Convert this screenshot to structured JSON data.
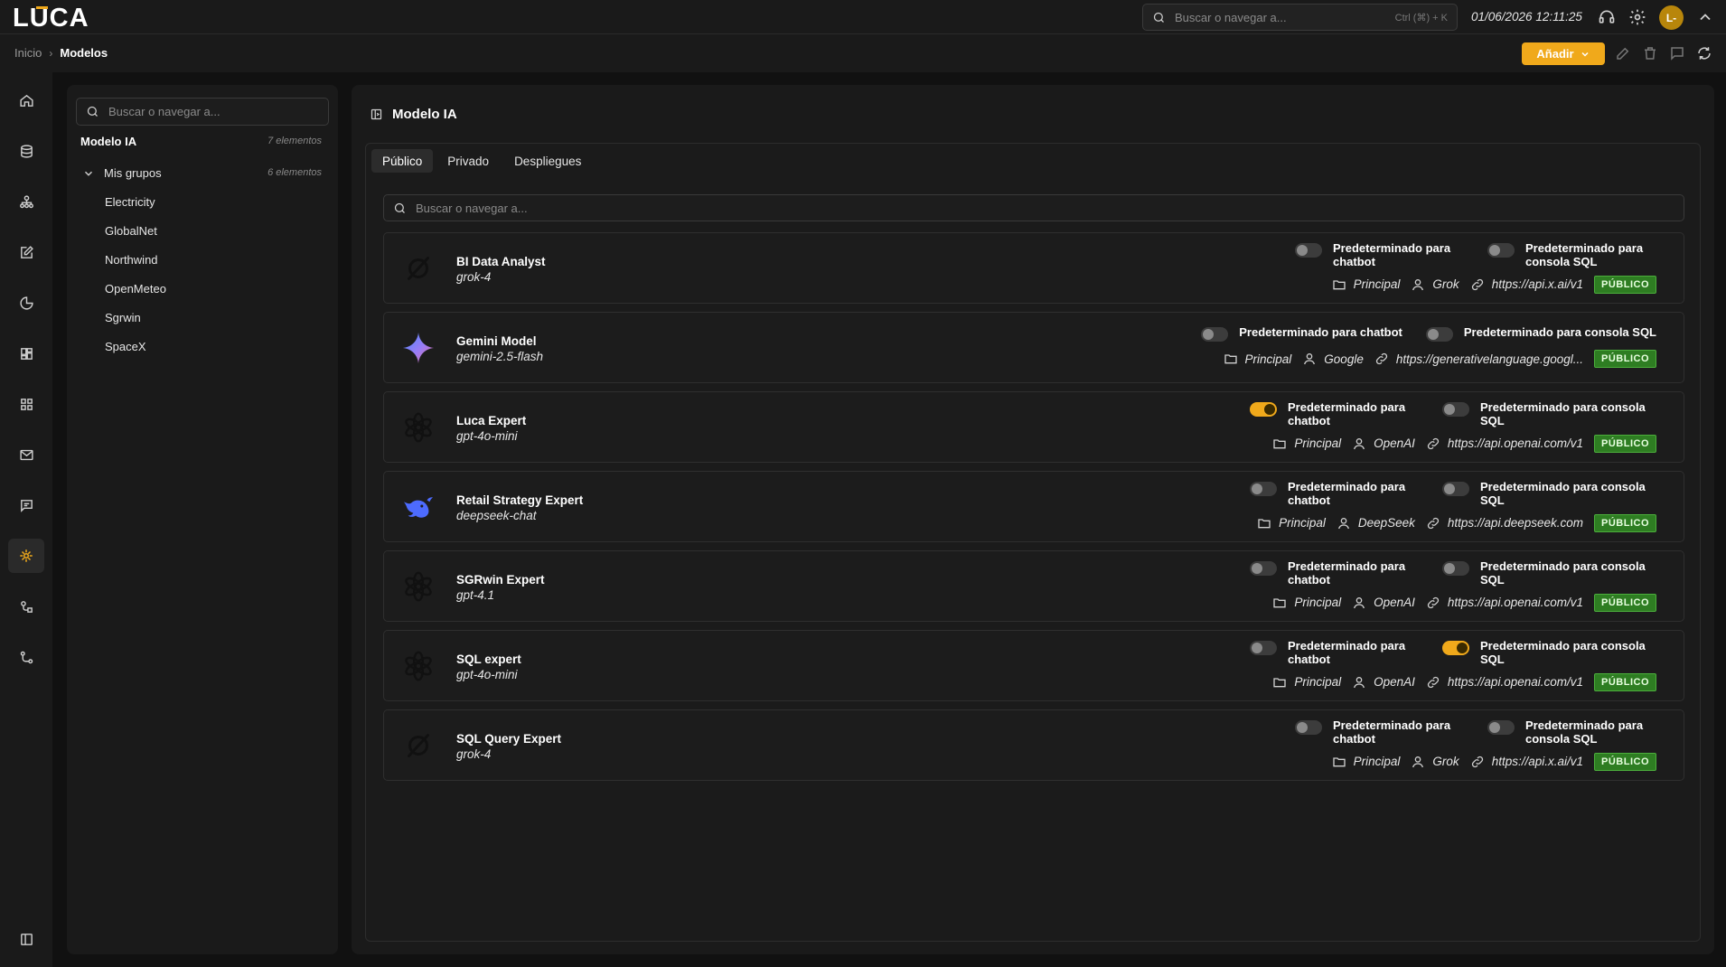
{
  "app": {
    "logo_text": "LUCA"
  },
  "topbar": {
    "search_placeholder": "Buscar o navegar a...",
    "search_shortcut": "Ctrl (⌘) + K",
    "datetime": "01/06/2026 12:11:25",
    "avatar_initials": "L-"
  },
  "breadcrumb": {
    "home": "Inicio",
    "current": "Modelos"
  },
  "actions": {
    "add_label": "Añadir"
  },
  "sidebar": {
    "search_placeholder": "Buscar o navegar a...",
    "title": "Modelo IA",
    "title_count": "7 elementos",
    "group_label": "Mis grupos",
    "group_count": "6 elementos",
    "items": [
      "Electricity",
      "GlobalNet",
      "Northwind",
      "OpenMeteo",
      "Sgrwin",
      "SpaceX"
    ]
  },
  "main": {
    "title": "Modelo IA",
    "tabs": [
      "Público",
      "Privado",
      "Despliegues"
    ],
    "search_placeholder": "Buscar o navegar a...",
    "toggle_chatbot_label": "Predeterminado para chatbot",
    "toggle_sql_label": "Predeterminado para consola SQL",
    "models": [
      {
        "name": "BI Data Analyst",
        "model": "grok-4",
        "icon": "grok-icon",
        "folder": "Principal",
        "provider": "Grok",
        "url": "https://api.x.ai/v1",
        "badge": "PÚBLICO",
        "chatbot": false,
        "sql": false
      },
      {
        "name": "Gemini Model",
        "model": "gemini-2.5-flash",
        "icon": "gemini-icon",
        "folder": "Principal",
        "provider": "Google",
        "url": "https://generativelanguage.googl...",
        "badge": "PÚBLICO",
        "chatbot": false,
        "sql": false
      },
      {
        "name": "Luca Expert",
        "model": "gpt-4o-mini",
        "icon": "openai-icon",
        "folder": "Principal",
        "provider": "OpenAI",
        "url": "https://api.openai.com/v1",
        "badge": "PÚBLICO",
        "chatbot": true,
        "sql": false
      },
      {
        "name": "Retail Strategy Expert",
        "model": "deepseek-chat",
        "icon": "deepseek-icon",
        "folder": "Principal",
        "provider": "DeepSeek",
        "url": "https://api.deepseek.com",
        "badge": "PÚBLICO",
        "chatbot": false,
        "sql": false
      },
      {
        "name": "SGRwin Expert",
        "model": "gpt-4.1",
        "icon": "openai-icon",
        "folder": "Principal",
        "provider": "OpenAI",
        "url": "https://api.openai.com/v1",
        "badge": "PÚBLICO",
        "chatbot": false,
        "sql": false
      },
      {
        "name": "SQL expert",
        "model": "gpt-4o-mini",
        "icon": "openai-icon",
        "folder": "Principal",
        "provider": "OpenAI",
        "url": "https://api.openai.com/v1",
        "badge": "PÚBLICO",
        "chatbot": false,
        "sql": true
      },
      {
        "name": "SQL Query Expert",
        "model": "grok-4",
        "icon": "grok-icon",
        "folder": "Principal",
        "provider": "Grok",
        "url": "https://api.x.ai/v1",
        "badge": "PÚBLICO",
        "chatbot": false,
        "sql": false
      }
    ]
  },
  "colors": {
    "accent": "#f0a91b",
    "badge": "#2e7d22",
    "background": "#111111",
    "panel": "#1a1a1a"
  }
}
